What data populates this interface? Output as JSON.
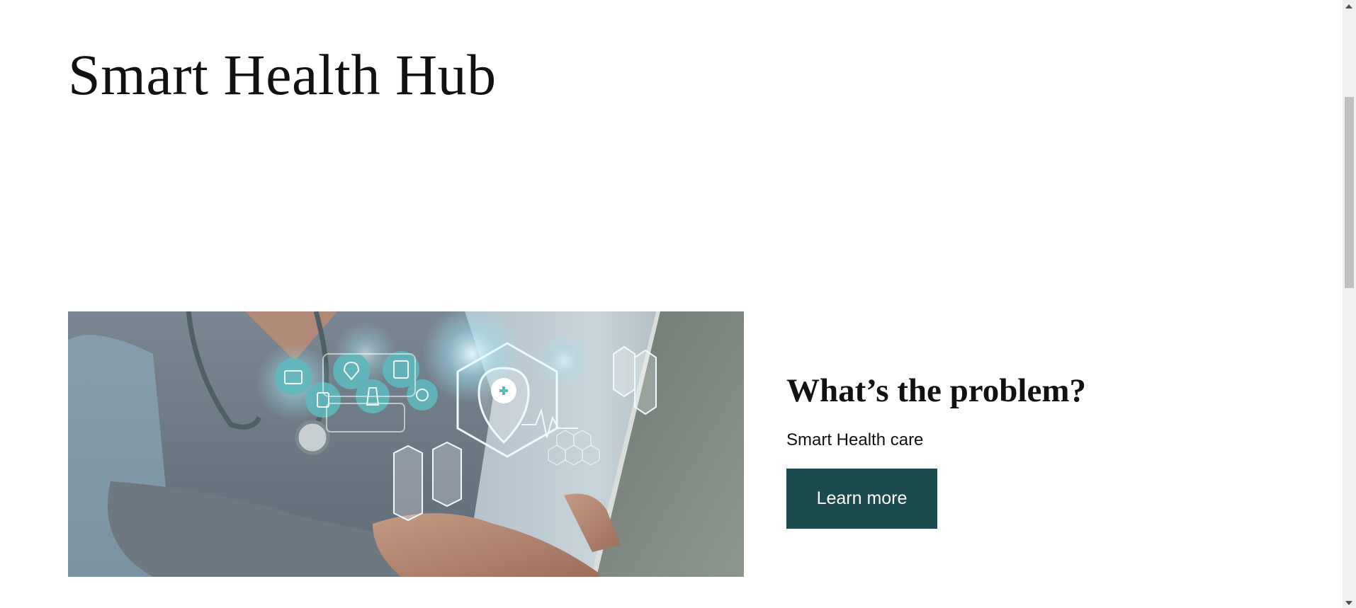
{
  "site": {
    "title": "Smart Health Hub"
  },
  "feature": {
    "heading": "What’s the problem?",
    "text": "Smart Health care",
    "button_label": "Learn more"
  },
  "colors": {
    "button_background": "#1c4b4f",
    "button_text": "#ffffff",
    "page_background": "#ffffff",
    "text": "#111111"
  },
  "hero_image": {
    "icon": "healthcare-technology-photo"
  }
}
